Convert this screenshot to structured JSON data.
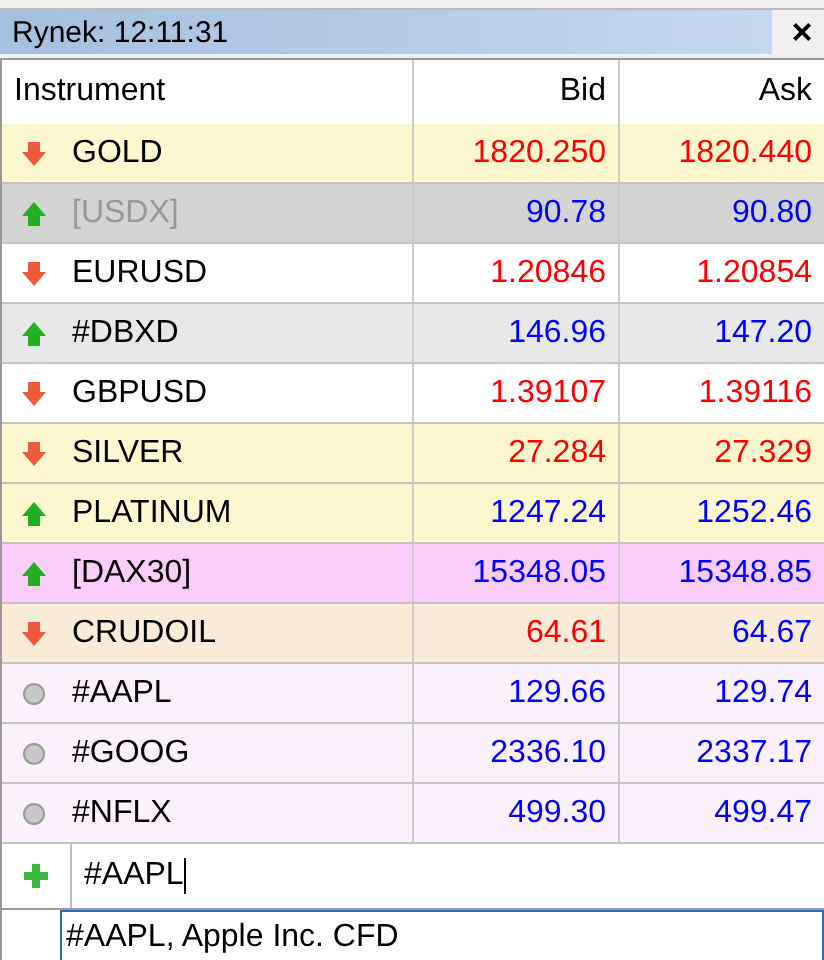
{
  "window": {
    "title": "Rynek: 12:11:31",
    "close": "×"
  },
  "table": {
    "columns": [
      "Instrument",
      "Bid",
      "Ask"
    ],
    "rows": [
      {
        "kind": "down",
        "name": "GOLD",
        "disabled": false,
        "color": "#fdf7cf",
        "bid": {
          "text": "1820.250",
          "color": "#ff0000"
        },
        "ask": {
          "text": "1820.440",
          "color": "#ff0000"
        }
      },
      {
        "kind": "up",
        "name": "[USDX]",
        "disabled": true,
        "color": "#d3d3d3",
        "bid": {
          "text": "90.78",
          "color": "#0000ff"
        },
        "ask": {
          "text": "90.80",
          "color": "#0000ff"
        }
      },
      {
        "kind": "down",
        "name": "EURUSD",
        "disabled": false,
        "color": "#ffffff",
        "bid": {
          "text": "1.20846",
          "color": "#ff0000"
        },
        "ask": {
          "text": "1.20854",
          "color": "#ff0000"
        }
      },
      {
        "kind": "up",
        "name": "#DBXD",
        "disabled": false,
        "color": "#e8e8e8",
        "bid": {
          "text": "146.96",
          "color": "#0000ff"
        },
        "ask": {
          "text": "147.20",
          "color": "#0000ff"
        }
      },
      {
        "kind": "down",
        "name": "GBPUSD",
        "disabled": false,
        "color": "#ffffff",
        "bid": {
          "text": "1.39107",
          "color": "#ff0000"
        },
        "ask": {
          "text": "1.39116",
          "color": "#ff0000"
        }
      },
      {
        "kind": "down",
        "name": "SILVER",
        "disabled": false,
        "color": "#fdf7cf",
        "bid": {
          "text": "27.284",
          "color": "#ff0000"
        },
        "ask": {
          "text": "27.329",
          "color": "#ff0000"
        }
      },
      {
        "kind": "up",
        "name": "PLATINUM",
        "disabled": false,
        "color": "#fdf7cf",
        "bid": {
          "text": "1247.24",
          "color": "#0000ff"
        },
        "ask": {
          "text": "1252.46",
          "color": "#0000ff"
        }
      },
      {
        "kind": "up",
        "name": "[DAX30]",
        "disabled": false,
        "color": "#f8cdf8",
        "bid": {
          "text": "15348.05",
          "color": "#0000ff"
        },
        "ask": {
          "text": "15348.85",
          "color": "#0000ff"
        }
      },
      {
        "kind": "down",
        "name": "CRUDOIL",
        "disabled": false,
        "color": "#f8ebd8",
        "bid": {
          "text": "64.61",
          "color": "#ff0000"
        },
        "ask": {
          "text": "64.67",
          "color": "#0000ff"
        }
      },
      {
        "kind": "none",
        "name": "#AAPL",
        "disabled": false,
        "color": "#fcf0fc",
        "bid": {
          "text": "129.66",
          "color": "#0000ff"
        },
        "ask": {
          "text": "129.74",
          "color": "#0000ff"
        }
      },
      {
        "kind": "none",
        "name": "#GOOG",
        "disabled": false,
        "color": "#fcf0fc",
        "bid": {
          "text": "2336.10",
          "color": "#0000ff"
        },
        "ask": {
          "text": "2337.17",
          "color": "#0000ff"
        }
      },
      {
        "kind": "none",
        "name": "#NFLX",
        "disabled": false,
        "color": "#fcf0fc",
        "bid": {
          "text": "499.30",
          "color": "#0000ff"
        },
        "ask": {
          "text": "499.47",
          "color": "#0000ff"
        }
      }
    ]
  },
  "add_symbol": {
    "value": "#AAPL",
    "suggestion": "#AAPL, Apple Inc. CFD"
  }
}
